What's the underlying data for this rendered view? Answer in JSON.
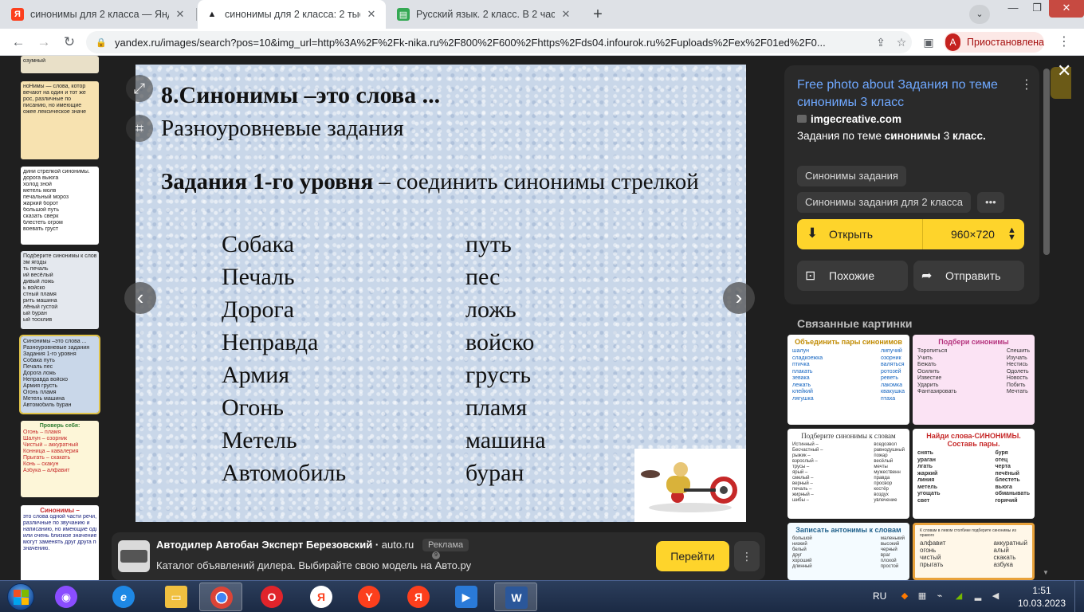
{
  "browser": {
    "tabs": [
      {
        "title": "синонимы для 2 класса — Янде",
        "favicon": "yandex-icon",
        "color": "#fc3f1d",
        "glyph": "Я"
      },
      {
        "title": "синонимы для 2 класса: 2 тыс и",
        "favicon": "yandex-images-icon",
        "color": "#202124",
        "glyph": "▲"
      },
      {
        "title": "Русский язык. 2 класс. В 2 частя",
        "favicon": "book-icon",
        "color": "#34a853",
        "glyph": "▤"
      }
    ],
    "new_tab": "+",
    "url": "yandex.ru/images/search?pos=10&img_url=http%3A%2F%2Fk-nika.ru%2F800%2F600%2Fhttps%2Fds04.infourok.ru%2Fuploads%2Fex%2F01ed%2F0...",
    "profile_initial": "А",
    "profile_status": "Приостановлена"
  },
  "thumbnails": [
    {
      "lines": [
        "озумный"
      ]
    },
    {
      "lines": [
        "ноНимы — слова, котор",
        "вечают на один и тот же",
        "рос, различные по",
        "писанию, но имеющие",
        "ожее лексическое значе"
      ]
    },
    {
      "lines": [
        "дини стрелкой синонимы.",
        "дорога    выюга",
        "холод      зной",
        "метель    молв",
        "печальный  мороз",
        "жаркий    борот",
        "большой   путь",
        "сказать    сверк",
        "блестеть  огром",
        "воевать    груст"
      ]
    },
    {
      "lines": [
        "Подберите синонимы к словам",
        "эм        ягоды",
        "ть        печаль",
        "ий        весёлый",
        "дивый     ложь",
        "ь          войско",
        "стный     пламя",
        "рить      машина",
        "лёный     густой",
        "ый        буран",
        "ый        тосклив"
      ]
    },
    {
      "lines": [
        "Синонимы –это слова ...",
        "Разноуровневые задания",
        "Задания 1-го уровня",
        "Собака     путь",
        "Печаль     пес",
        "Дорога     ложь",
        "Неправда   войско",
        "Армия      грусть",
        "Огонь      пламя",
        "Метель     машина",
        "Автомобиль буран"
      ]
    },
    {
      "lines": [
        "Проверь себя:",
        "Огонь – пламя",
        "Шалун – озорник",
        "Чистый – аккуратный",
        "Конница – кавалерия",
        "Прыгать – скакать",
        "Конь – скакун",
        "Азбука – алфавит"
      ]
    },
    {
      "lines": [
        "Синонимы –",
        "это слова одной части речи,",
        "различные по звучанию и",
        "написанию, но имеющие одинако",
        "или очень близкое значение. Он",
        "могут заменять друг друга по",
        "значению."
      ]
    }
  ],
  "slide": {
    "heading": "8.Синонимы –это слова ...",
    "subheading": "Разноуровневые задания",
    "task_bold": "Задания 1-го уровня",
    "task_rest": " – соединить синонимы стрелкой",
    "left_words": [
      "Собака",
      "Печаль",
      "Дорога",
      "Неправда",
      "Армия",
      "Огонь",
      "Метель",
      "Автомобиль"
    ],
    "right_words": [
      "путь",
      "пес",
      "ложь",
      "войско",
      "грусть",
      "пламя",
      "машина",
      "буран"
    ]
  },
  "ad": {
    "title": "Автодилер Автобан Эксперт Березовский",
    "domain": "auto.ru",
    "label": "Реклама",
    "badge": "9",
    "text": "Каталог объявлений дилера. Выбирайте свою модель на Авто.ру",
    "cta": "Перейти"
  },
  "panel": {
    "title": "Free photo about Задания по теме синонимы 3 класс",
    "site": "imgecreative.com",
    "desc_pre": "Задания по теме ",
    "desc_b1": "синонимы",
    "desc_mid": " 3 ",
    "desc_b2": "класс.",
    "tags": [
      "Синонимы задания",
      "Синонимы задания для 2 класса",
      "•••"
    ],
    "open_label": "Открыть",
    "size": "960×720",
    "similar_label": "Похожие",
    "share_label": "Отправить",
    "related_title": "Связанные картинки",
    "related": [
      {
        "title": "Объединить пары синонимов",
        "left": [
          "шалун",
          "сладкоежка",
          "птичка",
          "плакать",
          "зевака",
          "лежать",
          "клейкий",
          "лягушка"
        ],
        "right": [
          "липучий",
          "озорник",
          "валяться",
          "ротозей",
          "реветь",
          "лакомка",
          "квакушка",
          "птаха"
        ],
        "bg": "#fafafa",
        "hc": "#c08a00"
      },
      {
        "title": "Подбери синонимы",
        "left": [
          "Торопиться",
          "Учить",
          "Бежать",
          "Осилить",
          "Известие",
          "Ударить",
          "Фантазировать"
        ],
        "right": [
          "Спешить",
          "Изучать",
          "Нестись",
          "Одолеть",
          "Новость",
          "Побить",
          "Мечтать"
        ],
        "bg": "#fbe3f4",
        "hc": "#b4317c"
      },
      {
        "title": "Подберите синонимы к словам",
        "left": [
          "Истинный –",
          "Бесчастный –",
          "рыжик –",
          "взрослый –",
          "трусы –",
          "ярый –",
          "смелый –",
          "верный –",
          "печаль –",
          "жирный –",
          "шибы –"
        ],
        "right": [
          "вседозвол",
          "равнодушный",
          "пожар",
          "весёлый",
          "мечты",
          "мужественн",
          "правда",
          "просвор",
          "костёр",
          "воздух",
          "увлечение"
        ],
        "bg": "#ffffff",
        "hc": "#333333"
      },
      {
        "title": "Найди слова-СИНОНИМЫ. Составь пары.",
        "left": [
          "снять",
          "ураган",
          "лгать",
          "жаркий",
          "линия",
          "метель",
          "угощать",
          "свет"
        ],
        "right": [
          "буря",
          "отец",
          "черта",
          "печёный",
          "блестеть",
          "вьюга",
          "обманывать",
          "горячий"
        ],
        "bg": "#ffffff",
        "hc": "#c62828"
      },
      {
        "title": "Записать антонимы к словам",
        "left": [
          "большой",
          "низкий",
          "белый",
          "друг",
          "хороший",
          "длинный"
        ],
        "right": [
          "маленький",
          "высокий",
          "черный",
          "враг",
          "плохой",
          "простой"
        ],
        "bg": "#f4fbff",
        "hc": "#1e5f8a"
      },
      {
        "title": "К словам в левом столбике подберите синонимы из правого",
        "left": [
          "алфавит",
          "огонь",
          "чистый",
          "прыгать"
        ],
        "right": [
          "аккуратный",
          "алый",
          "скакать",
          "азбука"
        ],
        "bg": "#fff7e8",
        "hc": "#555555"
      }
    ]
  },
  "taskbar": {
    "lang": "RU",
    "time": "1:51",
    "date": "10.03.2023",
    "apps": [
      {
        "name": "alice-icon",
        "color": "#8a4dff",
        "glyph": "◉"
      },
      {
        "name": "internet-explorer-icon",
        "color": "#1e88e5",
        "glyph": "e"
      },
      {
        "name": "file-explorer-icon",
        "color": "#f0c040",
        "glyph": "▭"
      },
      {
        "name": "chrome-icon",
        "color": "#db4437",
        "glyph": "◎",
        "active": true
      },
      {
        "name": "opera-icon",
        "color": "#e0242b",
        "glyph": "O"
      },
      {
        "name": "yandex-browser-icon",
        "color": "#e8e8e8",
        "glyph": "Я"
      },
      {
        "name": "yandex-icon",
        "color": "#fc3f1d",
        "glyph": "Y"
      },
      {
        "name": "yandex-app-icon",
        "color": "#fc3f1d",
        "glyph": "Я"
      },
      {
        "name": "media-player-icon",
        "color": "#2a7ad8",
        "glyph": "▶"
      },
      {
        "name": "word-icon",
        "color": "#2b579a",
        "glyph": "W",
        "active": true
      }
    ]
  }
}
